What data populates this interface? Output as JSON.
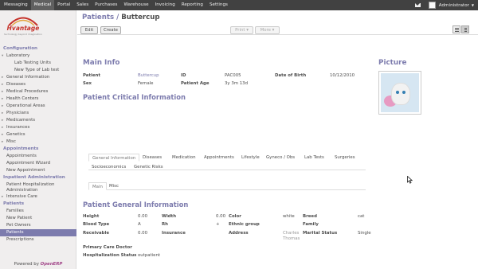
{
  "top_menu": [
    "Messaging",
    "Medical",
    "Portal",
    "Sales",
    "Purchases",
    "Warehouse",
    "Invoicing",
    "Reporting",
    "Settings"
  ],
  "user_name": "Administrator",
  "logo": {
    "name": "Hvantage",
    "tagline": "technology beyond imagination"
  },
  "sidebar": {
    "config_title": "Configuration",
    "laboratory": "Laboratory",
    "lab_units": "Lab Testing Units",
    "lab_type": "New Type of Lab test",
    "config_items": [
      "General Information",
      "Diseases",
      "Medical Procedures",
      "Health Centers",
      "Operational Areas",
      "Physicians",
      "Medicaments",
      "Insurances",
      "Genetics",
      "Misc"
    ],
    "appointments_title": "Appointments",
    "appointments_items": [
      "Appointments",
      "Appointment Wizard",
      "New Appointment"
    ],
    "inpatient_title": "Inpatient Administration",
    "inpatient_hosp": "Patient Hospitalization Administration",
    "intensive_care": "Intensive Care",
    "patients_title": "Patients",
    "patients_items": [
      "Families",
      "New Patient",
      "Pet Owners",
      "Patients",
      "Prescriptions"
    ],
    "powered_by": "Powered by",
    "powered_brand": "OpenERP"
  },
  "breadcrumb": {
    "parent": "Patients",
    "sep": " / ",
    "current": "Buttercup"
  },
  "buttons": {
    "edit": "Edit",
    "create": "Create",
    "print": "Print ▾",
    "more": "More ▾"
  },
  "colors": {
    "accent": "#7c7bad",
    "topbar": "#414141",
    "sidebar_bg": "#f0eeee"
  },
  "main_info": {
    "title": "Main Info",
    "patient_label": "Patient",
    "patient_value": "Buttercup",
    "id_label": "ID",
    "id_value": "PAC005",
    "dob_label": "Date of Birth",
    "dob_value": "10/12/2010",
    "sex_label": "Sex",
    "sex_value": "Female",
    "age_label": "Patient Age",
    "age_value": "3y 3m 13d"
  },
  "critical_title": "Patient Critical Information",
  "picture_title": "Picture",
  "tabs_row1": [
    "General Information",
    "Diseases",
    "Medication",
    "Appointments",
    "Lifestyle",
    "Gyneco / Obs",
    "Lab Tests",
    "Surgeries"
  ],
  "tabs_row2": [
    "Socioeconomics",
    "Genetic Risks"
  ],
  "subtabs": [
    "Main",
    "Misc"
  ],
  "general": {
    "title": "Patient General Information",
    "height_label": "Height",
    "height_value": "0.00",
    "width_label": "Width",
    "width_value": "0.00",
    "color_label": "Color",
    "color_value": "white",
    "breed_label": "Breed",
    "breed_value": "cat",
    "blood_label": "Blood Type",
    "blood_value": "A",
    "rh_label": "Rh",
    "rh_value": "+",
    "ethnic_label": "Ethnic group",
    "family_label": "Family",
    "receivable_label": "Receivable",
    "receivable_value": "0.00",
    "insurance_label": "Insurance",
    "address_label": "Address",
    "address_value": "Charles Thomas",
    "marital_label": "Marital Status",
    "marital_value": "Single",
    "pcd_label": "Primary Care Doctor",
    "hosp_label": "Hospitalization Status",
    "hosp_value": "outpatient"
  }
}
